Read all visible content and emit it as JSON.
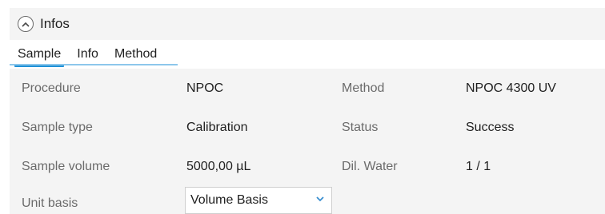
{
  "header": {
    "title": "Infos",
    "collapse_icon": "chevron-up-circle-icon"
  },
  "tabs": [
    {
      "label": "Sample",
      "active": true
    },
    {
      "label": "Info",
      "active": false
    },
    {
      "label": "Method",
      "active": false
    }
  ],
  "fields": {
    "procedure": {
      "label": "Procedure",
      "value": "NPOC"
    },
    "sample_type": {
      "label": "Sample type",
      "value": "Calibration"
    },
    "sample_volume": {
      "label": "Sample volume",
      "value": "5000,00 µL"
    },
    "unit_basis": {
      "label": "Unit basis",
      "value": "Volume Basis"
    },
    "method": {
      "label": "Method",
      "value": "NPOC 4300 UV"
    },
    "status": {
      "label": "Status",
      "value": "Success"
    },
    "dil_water": {
      "label": "Dil. Water",
      "value": "1 / 1"
    }
  },
  "colors": {
    "accent": "#1e90d6",
    "tab_line": "#8cc7eb",
    "panel_bg": "#f4f4f4",
    "label_text": "#6b6b6b"
  }
}
